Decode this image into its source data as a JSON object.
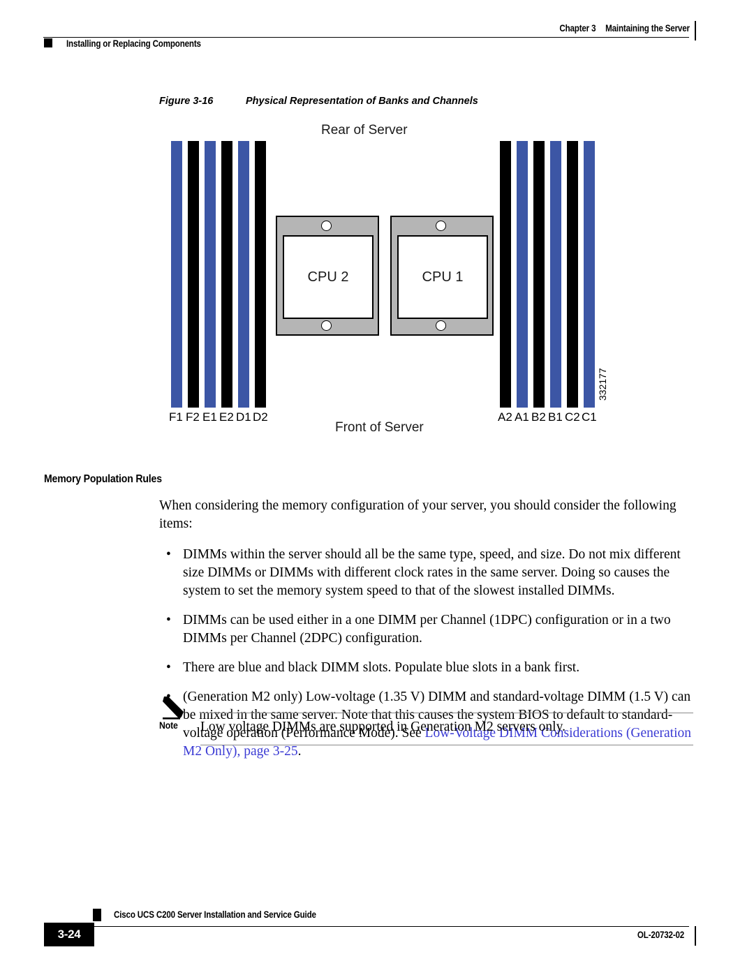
{
  "header": {
    "chapter_number": "Chapter 3",
    "chapter_title": "Maintaining the Server",
    "section_title": "Installing or Replacing Components"
  },
  "figure": {
    "number": "Figure 3-16",
    "title": "Physical Representation of Banks and Channels",
    "rear_label": "Rear of Server",
    "front_label": "Front of Server",
    "figure_id": "332177",
    "cpu_left_label": "CPU 2",
    "cpu_right_label": "CPU 1",
    "left_slots": [
      {
        "label": "F1",
        "color": "blue"
      },
      {
        "label": "F2",
        "color": "black"
      },
      {
        "label": "E1",
        "color": "blue"
      },
      {
        "label": "E2",
        "color": "black"
      },
      {
        "label": "D1",
        "color": "blue"
      },
      {
        "label": "D2",
        "color": "black"
      }
    ],
    "right_slots": [
      {
        "label": "A2",
        "color": "black"
      },
      {
        "label": "A1",
        "color": "blue"
      },
      {
        "label": "B2",
        "color": "black"
      },
      {
        "label": "B1",
        "color": "blue"
      },
      {
        "label": "C2",
        "color": "black"
      },
      {
        "label": "C1",
        "color": "blue"
      }
    ],
    "colors": {
      "blue_slot": "#3c56a5",
      "black_slot": "#000000",
      "cpu_frame": "#b5b5b5"
    }
  },
  "content": {
    "section_heading": "Memory Population Rules",
    "intro": "When considering the memory configuration of your server, you should consider the following items:",
    "bullet_char": "•",
    "bullets": [
      "DIMMs within the server should all be the same type, speed, and size. Do not mix different size DIMMs or DIMMs with different clock rates in the same server. Doing so causes the system to set the memory system speed to that of the slowest installed DIMMs.",
      "DIMMs can be used either in a one DIMM per Channel (1DPC) configuration or in a two DIMMs per Channel (2DPC) configuration.",
      "There are blue and black DIMM slots. Populate blue slots in a bank first."
    ],
    "bullet4": {
      "pre": "(Generation M2 only) Low-voltage (1.35 V) DIMM and standard-voltage DIMM (1.5 V) can be mixed in the same server. Note that this causes the system BIOS to default to standard-voltage operation (Performance Mode). See ",
      "link_text": "Low-Voltage DIMM Considerations (Generation M2 Only), page 3-25",
      "post": ".",
      "link_color": "#3b3bd4"
    }
  },
  "note": {
    "label": "Note",
    "text": "Low voltage DIMMs are supported in Generation M2 servers only."
  },
  "footer": {
    "book_title": "Cisco UCS C200 Server Installation and Service Guide",
    "page_number": "3-24",
    "doc_id": "OL-20732-02"
  }
}
